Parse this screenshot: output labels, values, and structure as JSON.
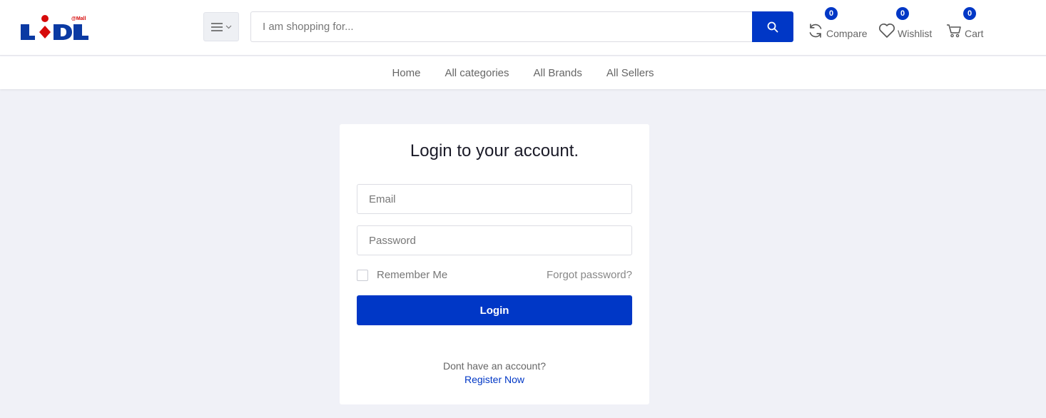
{
  "brand": {
    "logo_text": "LiDL",
    "logo_superscript": "@Mall",
    "logo_colors": {
      "blue": "#0b3aa3",
      "red": "#d60a0a"
    }
  },
  "header": {
    "search_placeholder": "I am shopping for...",
    "compare": {
      "label": "Compare",
      "count": "0",
      "icon": "refresh-icon"
    },
    "wishlist": {
      "label": "Wishlist",
      "count": "0",
      "icon": "heart-icon"
    },
    "cart": {
      "label": "Cart",
      "count": "0",
      "icon": "cart-icon"
    }
  },
  "nav": {
    "items": [
      {
        "label": "Home"
      },
      {
        "label": "All categories"
      },
      {
        "label": "All Brands"
      },
      {
        "label": "All Sellers"
      }
    ]
  },
  "login": {
    "title": "Login to your account.",
    "email_placeholder": "Email",
    "password_placeholder": "Password",
    "remember_label": "Remember Me",
    "forgot_label": "Forgot password?",
    "submit_label": "Login",
    "no_account_text": "Dont have an account?",
    "register_label": "Register Now"
  },
  "colors": {
    "accent": "#0037c6",
    "page_bg": "#f0f1f7"
  }
}
